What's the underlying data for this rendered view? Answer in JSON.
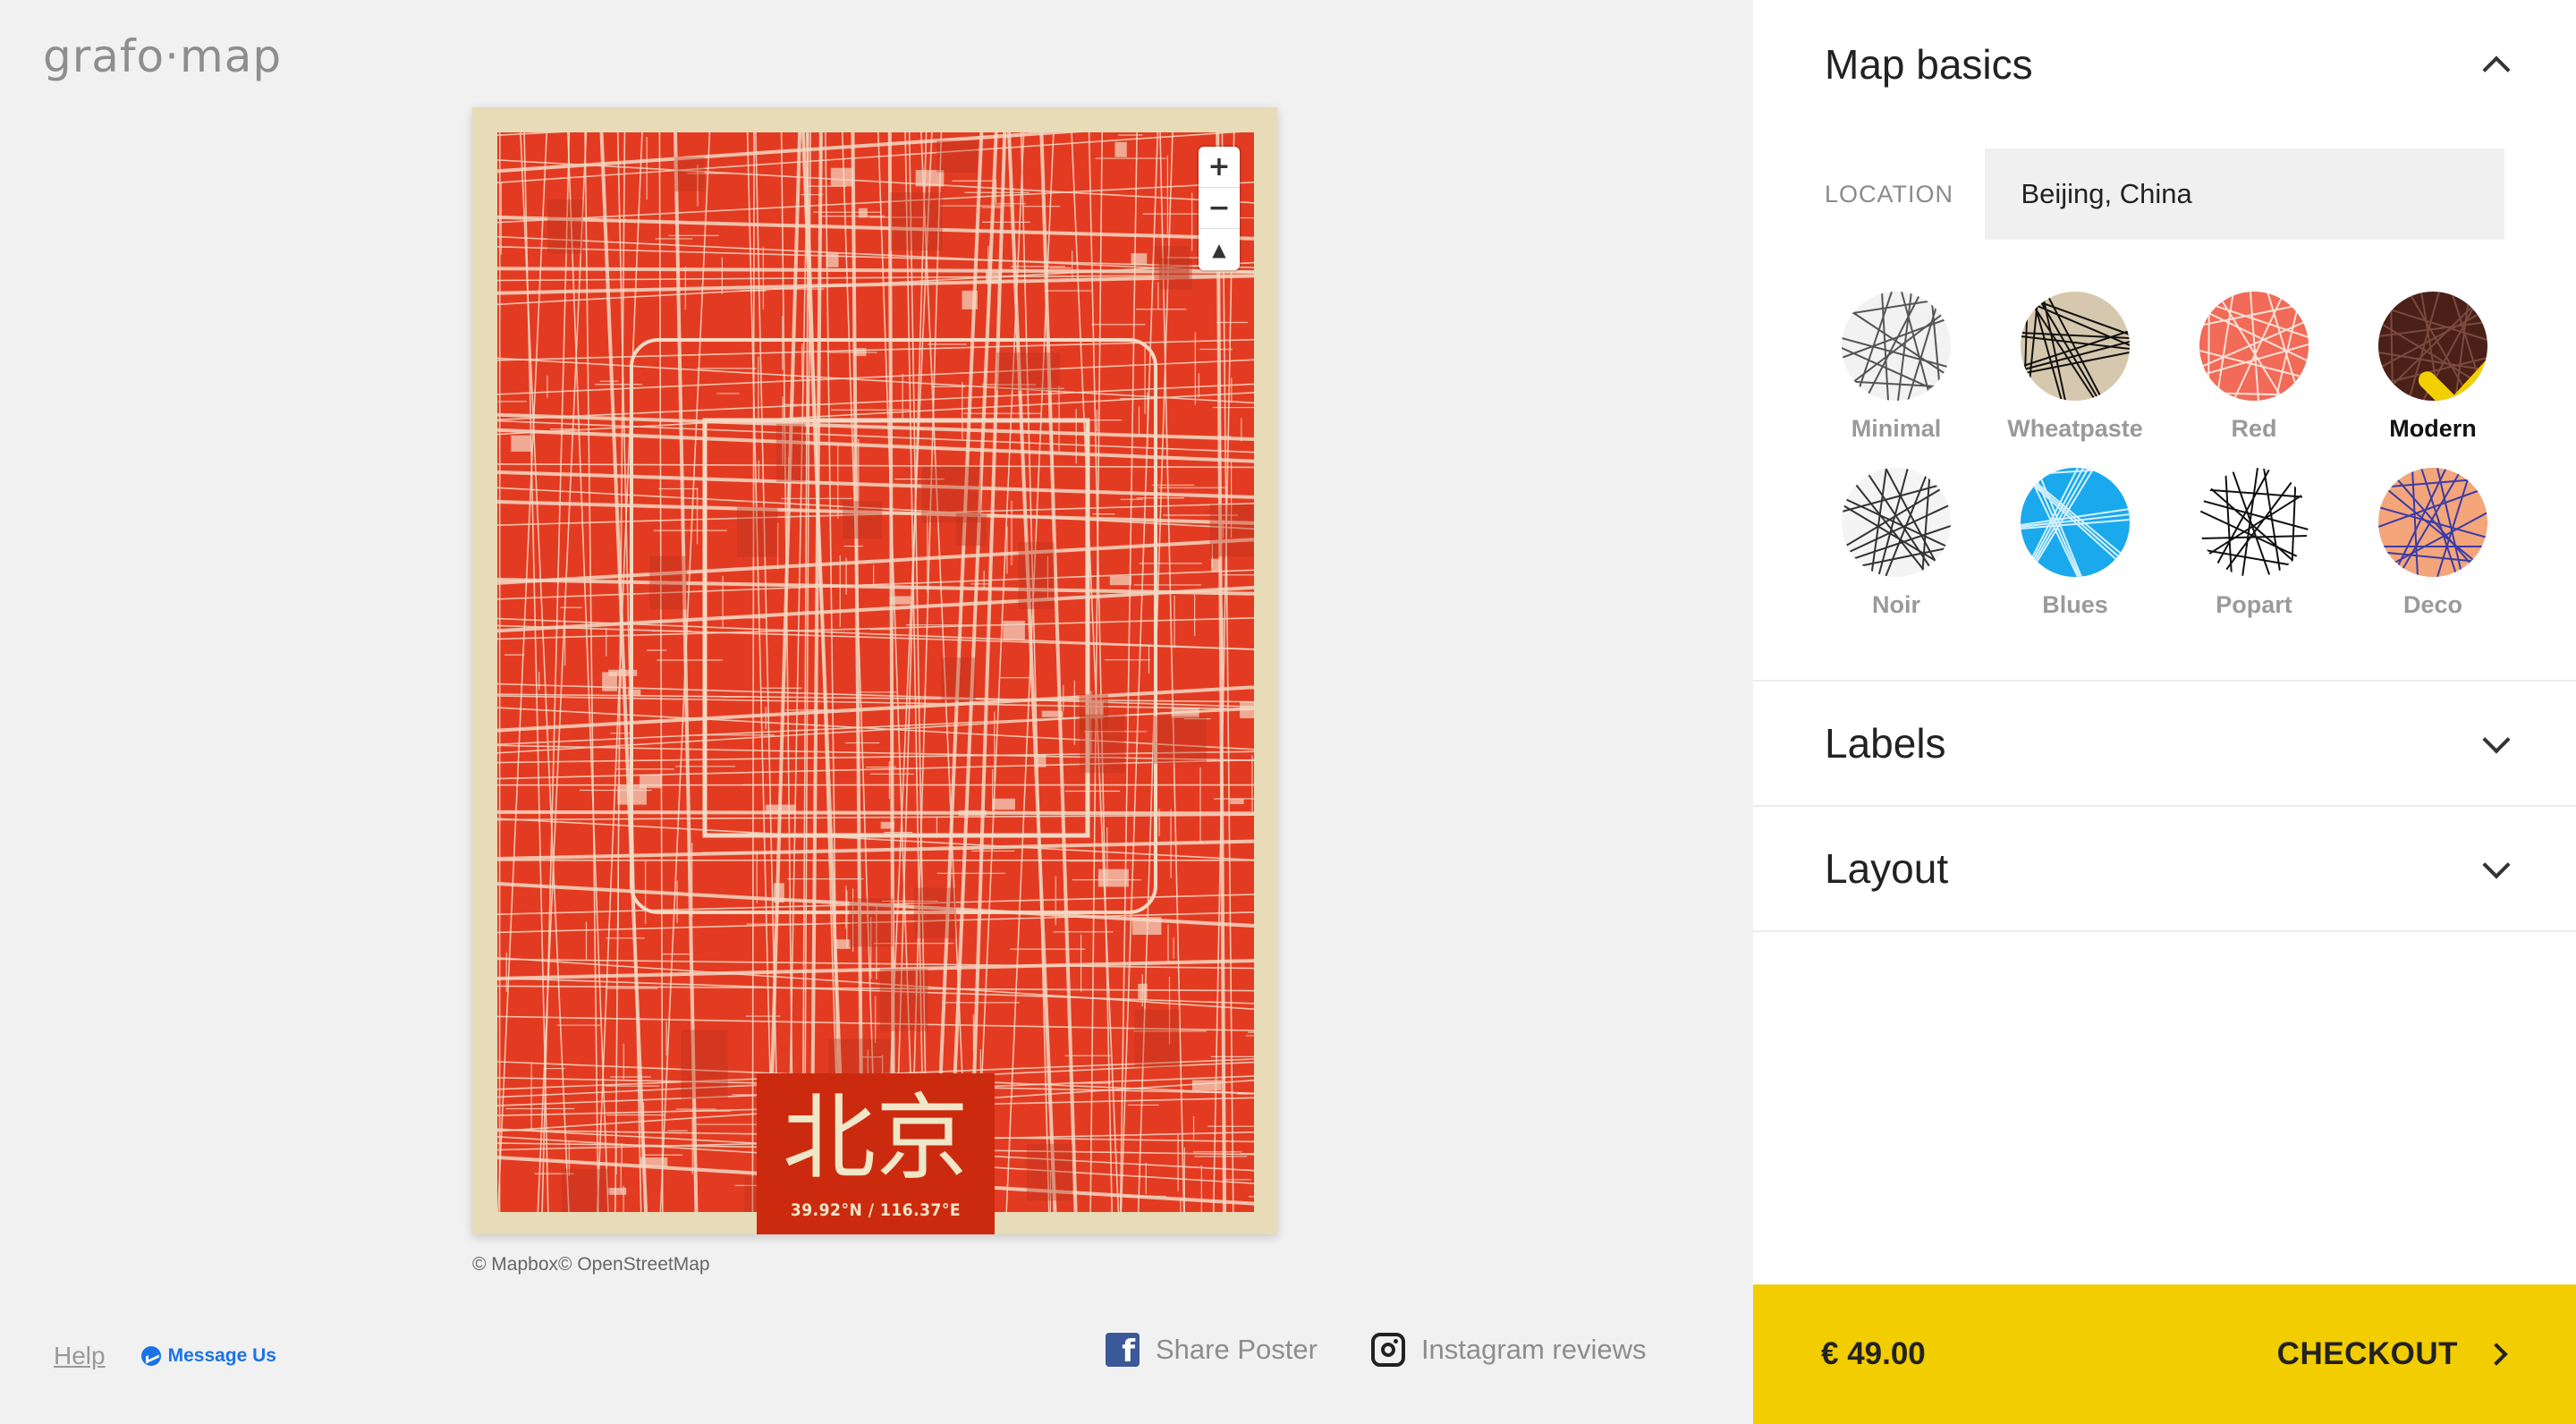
{
  "brand": {
    "logo_text": "grafo·map"
  },
  "poster": {
    "city_label": "北京",
    "coordinates": "39.92°N / 116.37°E",
    "attribution": "© Mapbox© OpenStreetMap"
  },
  "map_controls": {
    "zoom_in": "+",
    "zoom_out": "−",
    "compass": "▲"
  },
  "footer": {
    "help": "Help",
    "message_us": "Message Us",
    "share_poster": "Share Poster",
    "instagram_reviews": "Instagram reviews"
  },
  "panel": {
    "basics_title": "Map basics",
    "location_label": "LOCATION",
    "location_value": "Beijing, China",
    "styles": [
      {
        "name": "Minimal",
        "selected": false,
        "bg": "#f2f2f2",
        "line": "#555555"
      },
      {
        "name": "Wheatpaste",
        "selected": false,
        "bg": "#d6c8ae",
        "line": "#111111"
      },
      {
        "name": "Red",
        "selected": false,
        "bg": "#f26a58",
        "line": "#fbe1d8"
      },
      {
        "name": "Modern",
        "selected": true,
        "bg": "#4a2018",
        "line": "#7a4a3e"
      },
      {
        "name": "Noir",
        "selected": false,
        "bg": "#f4f4f4",
        "line": "#333333"
      },
      {
        "name": "Blues",
        "selected": false,
        "bg": "#1aa9ec",
        "line": "#d6f1ff"
      },
      {
        "name": "Popart",
        "selected": false,
        "bg": "#ffffff",
        "line": "#111111"
      },
      {
        "name": "Deco",
        "selected": false,
        "bg": "#f4a57a",
        "line": "#3a3ca8"
      }
    ],
    "labels_title": "Labels",
    "layout_title": "Layout"
  },
  "checkout": {
    "price": "€ 49.00",
    "button_label": "CHECKOUT"
  },
  "colors": {
    "accent_yellow": "#f2cd00",
    "map_red": "#e33b22",
    "poster_frame": "#e8dbb8",
    "label_red": "#cc2a0e",
    "check_yellow": "#f2d000"
  }
}
